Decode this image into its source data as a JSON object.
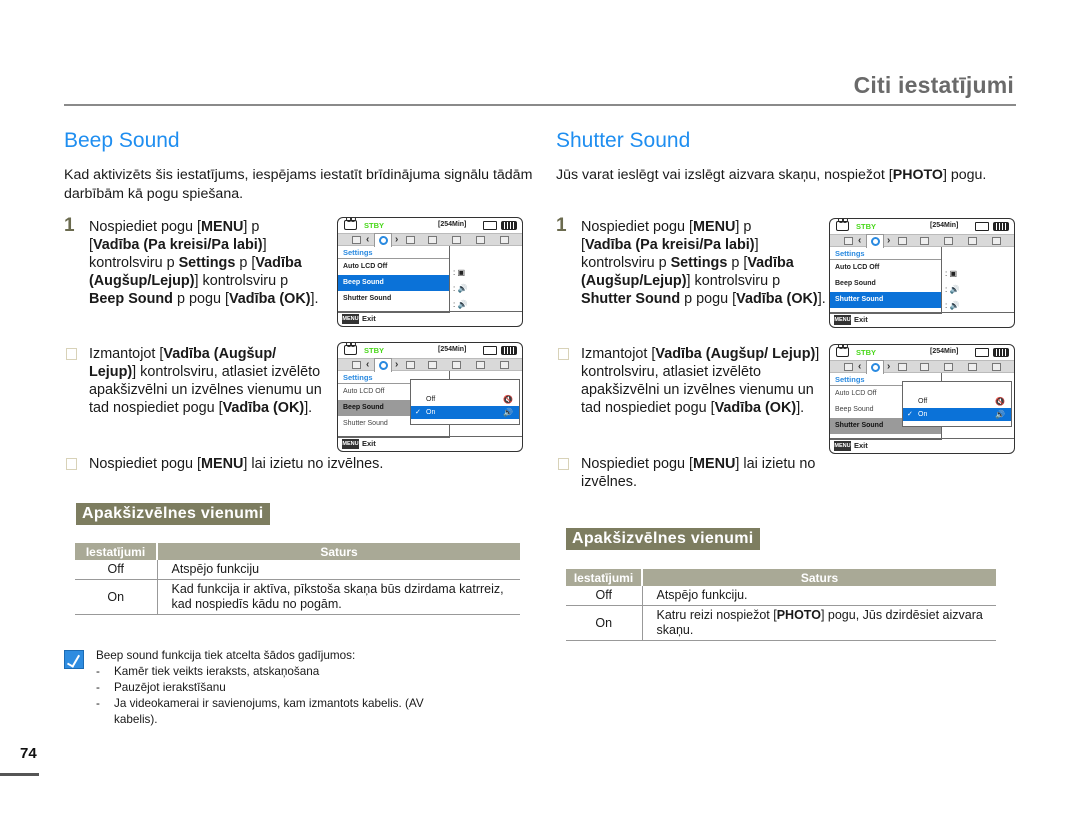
{
  "header": {
    "title": "Citi iestatījumi"
  },
  "page_number": "74",
  "beep": {
    "title": "Beep Sound",
    "intro": "Kad aktivizēts šis iestatījums, iespējams iestatīt brīdinājuma signālu tādām darbībām kā pogu spiešana.",
    "step1": {
      "num": "1",
      "parts": [
        "Nospiediet pogu [",
        "MENU",
        "]  p ",
        "[",
        "Vadība (Pa kreisi/Pa labi)",
        "] kontrolsviru  p ",
        "Settings",
        "  p ",
        "[",
        "Vadība (Augšup/Lejup)",
        "] kontrolsviru  p ",
        "Beep Sound",
        "  p pogu [",
        "Vadība (OK)",
        "]."
      ]
    },
    "step2": {
      "parts": [
        "Izmantojot [",
        "Vadība (Augšup/ Lejup)",
        "] kontrolsviru, atlasiet izvēlēto apakšizvēlni un izvēlnes vienumu un tad nospiediet pogu [",
        "Vadība (OK)",
        "]."
      ]
    },
    "step3": {
      "parts": [
        "Nospiediet pogu [",
        "MENU",
        "] lai izietu no izvēlnes."
      ]
    },
    "subhead": "Apakšizvēlnes vienumi",
    "table": {
      "headers": [
        "Iestatījumi",
        "Saturs"
      ],
      "rows": [
        {
          "setting": "Off",
          "content": "Atspējo funkciju"
        },
        {
          "setting": "On",
          "content": "Kad funkcija ir aktīva, pīkstoša skaņa būs dzirdama katrreiz, kad nospiedīs kādu no pogām."
        }
      ]
    },
    "note": {
      "icon": "note-pencil-icon",
      "lead": "Beep sound funkcija tiek atcelta šādos gadījumos:",
      "items": [
        "Kamēr tiek veikts ieraksts, atskaņošana",
        "Pauzējot ierakstīšanu",
        "Ja videokamerai ir savienojums, kam izmantots kabelis. (AV kabelis)."
      ]
    }
  },
  "shutter": {
    "title": "Shutter Sound",
    "intro_parts": [
      "Jūs varat ieslēgt vai izslēgt aizvara skaņu, nospiežot [",
      "PHOTO",
      "] pogu."
    ],
    "step1": {
      "num": "1",
      "parts": [
        "Nospiediet pogu [",
        "MENU",
        "]  p ",
        "[",
        "Vadība (Pa kreisi/Pa labi)",
        "] kontrolsviru  p ",
        "Settings",
        "  p [",
        "Vadība (Augšup/Lejup)",
        "] kontrolsviru  p ",
        "Shutter Sound",
        "  p pogu [",
        "Vadība (OK)",
        "]."
      ]
    },
    "step2": {
      "parts": [
        "Izmantojot [",
        "Vadība (Augšup/ Lejup)",
        "] kontrolsviru, atlasiet izvēlēto apakšizvēlni un izvēlnes vienumu un tad nospiediet pogu [",
        "Vadība (OK)",
        "]."
      ]
    },
    "step3": {
      "parts": [
        "Nospiediet pogu [",
        "MENU",
        "] lai izietu no izvēlnes."
      ]
    },
    "subhead": "Apakšizvēlnes vienumi",
    "table": {
      "headers": [
        "Iestatījumi",
        "Saturs"
      ],
      "rows": [
        {
          "setting": "Off",
          "content": "Atspējo funkciju."
        },
        {
          "setting": "On",
          "content_parts": [
            "Katru reizi nospiežot [",
            "PHOTO",
            "] pogu, Jūs dzirdēsiet aizvara skaņu."
          ]
        }
      ]
    }
  },
  "camera_screen": {
    "status": "STBY",
    "remaining": "[254Min]",
    "menu_header": "Settings",
    "menu_items": [
      "Auto LCD Off",
      "Beep Sound",
      "Shutter Sound"
    ],
    "submenu_options": [
      "Off",
      "On"
    ],
    "exit_button": "MENU",
    "exit_label": "Exit",
    "colors": {
      "status_green": "#49d81a",
      "selection_blue": "#0b72d8",
      "header_blue": "#2a8ae0"
    }
  },
  "colors": {
    "title_blue": "#1f8ef0",
    "subhead_bg": "#7d7d60",
    "table_header_bg": "#a9a996"
  }
}
